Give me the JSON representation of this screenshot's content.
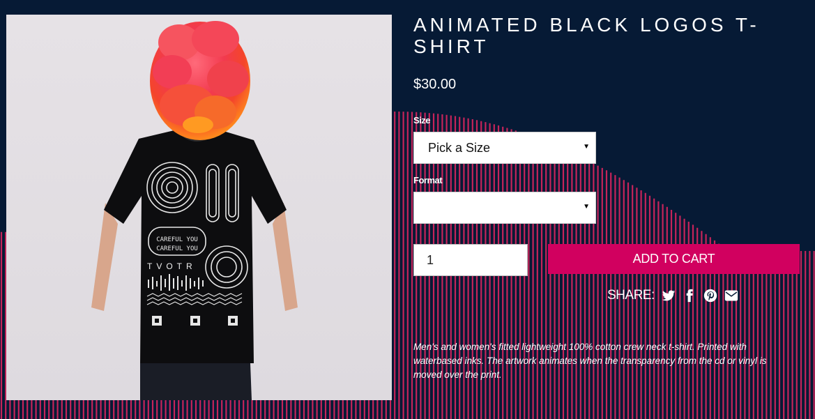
{
  "product": {
    "title": "ANIMATED BLACK LOGOS T-SHIRT",
    "price": "$30.00",
    "image_alt": "Man wearing black t-shirt with animated logo print, head obscured by red-orange blob",
    "shirt_print_text": {
      "band_text": "CAREFUL YOU",
      "logo_word": "TVOTR"
    }
  },
  "form": {
    "size_label": "Size",
    "size_selected": "Pick a Size",
    "format_label": "Format",
    "format_selected": "",
    "quantity": "1",
    "add_to_cart_label": "ADD TO CART"
  },
  "share": {
    "label": "SHARE:",
    "icons": [
      "twitter-icon",
      "facebook-icon",
      "pinterest-icon",
      "email-icon"
    ]
  },
  "description": "Men's and women's fitted lightweight 100% cotton crew neck t-shirt. Printed with waterbased inks. The artwork animates when the transparency from the cd or vinyl is moved over the print.",
  "colors": {
    "background": "#061a35",
    "accent": "#d1005f",
    "stripes": "#c5245a"
  }
}
